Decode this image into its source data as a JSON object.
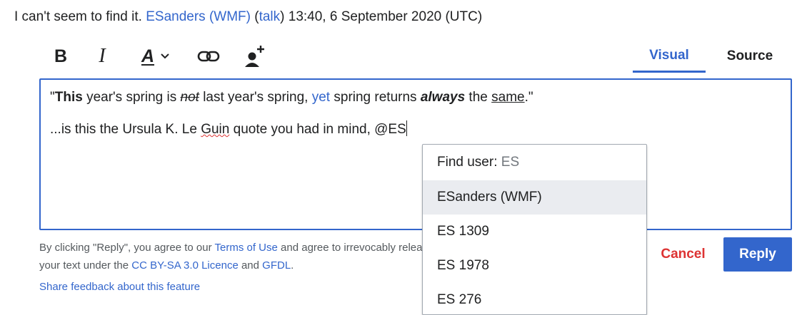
{
  "signature": {
    "text": "I can't seem to find it.",
    "user_link": "ESanders (WMF)",
    "talk_open": "(",
    "talk_link": "talk",
    "talk_close": ")",
    "timestamp": "13:40, 6 September 2020 (UTC)"
  },
  "toolbar": {
    "bold": "B",
    "italic": "I",
    "style": "A",
    "tabs": [
      {
        "label": "Visual",
        "active": true
      },
      {
        "label": "Source",
        "active": false
      }
    ]
  },
  "editor": {
    "line1": {
      "q_open": "\"",
      "bold_this": "This",
      "t1": " year's spring is ",
      "strike_not": "not",
      "t2": " last year's spring, ",
      "link_yet": "yet",
      "t3": " spring returns ",
      "bold_always": "always",
      "t4": " the ",
      "under_same": "same",
      "t5": ".\""
    },
    "line2": {
      "t1": "...is this the Ursula K. Le ",
      "misspelled": "Guin",
      "t2": " quote you had in mind, @ES"
    }
  },
  "mention_menu": {
    "header_label": "Find user:",
    "query": "ES",
    "items": [
      {
        "label": "ESanders (WMF)",
        "highlighted": true
      },
      {
        "label": "ES 1309",
        "highlighted": false
      },
      {
        "label": "ES 1978",
        "highlighted": false
      },
      {
        "label": "ES 276",
        "highlighted": false
      }
    ]
  },
  "legal": {
    "t1": "By clicking \"Reply\", you agree to our ",
    "terms_link": "Terms of Use",
    "t2": " and agree to irrevocably release your text under the ",
    "license_link": "CC BY-SA 3.0 Licence",
    "t3": " and ",
    "gfdl_link": "GFDL",
    "t4": "."
  },
  "feedback_link": "Share feedback about this feature",
  "actions": {
    "cancel": "Cancel",
    "reply": "Reply"
  },
  "colors": {
    "accent": "#3366cc",
    "destructive": "#d33",
    "text": "#202122",
    "muted": "#54595d"
  },
  "icons": [
    "chevron-down-icon",
    "link-icon",
    "mention-user-icon"
  ]
}
